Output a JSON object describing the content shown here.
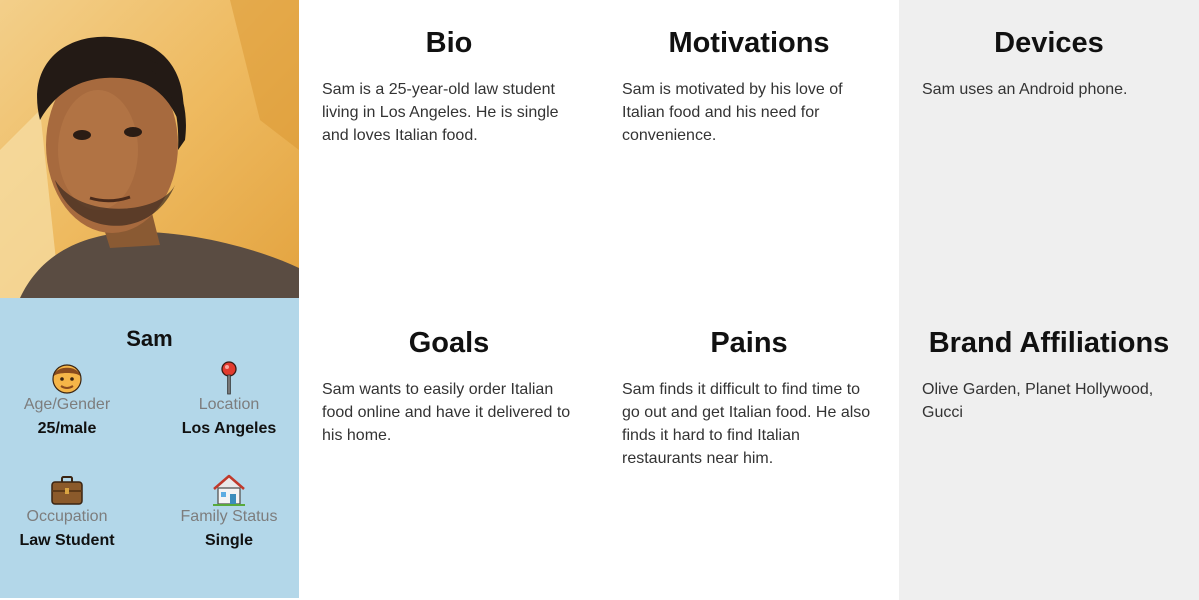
{
  "persona": {
    "name": "Sam",
    "attributes": [
      {
        "icon": "man-face-icon",
        "label": "Age/Gender",
        "value": "25/male"
      },
      {
        "icon": "location-pin-icon",
        "label": "Location",
        "value": "Los Angeles"
      },
      {
        "icon": "briefcase-icon",
        "label": "Occupation",
        "value": "Law Student"
      },
      {
        "icon": "house-icon",
        "label": "Family Status",
        "value": "Single"
      }
    ]
  },
  "sections": [
    {
      "title": "Bio",
      "text": "Sam is a 25-year-old law student living in Los Angeles. He is single and loves Italian food."
    },
    {
      "title": "Motivations",
      "text": "Sam is motivated by his love of Italian food and his need for convenience."
    },
    {
      "title": "Devices",
      "text": "Sam uses an Android phone."
    },
    {
      "title": "Goals",
      "text": "Sam wants to easily order Italian food online and have it delivered to his home."
    },
    {
      "title": "Pains",
      "text": "Sam finds it difficult to find time to go out and get Italian food. He also finds it hard to find Italian restaurants near him."
    },
    {
      "title": "Brand Affiliations",
      "text": "Olive Garden, Planet Hollywood, Gucci"
    }
  ],
  "colors": {
    "profile_bg": "#b3d7e9",
    "grey_panel": "#efefef"
  }
}
